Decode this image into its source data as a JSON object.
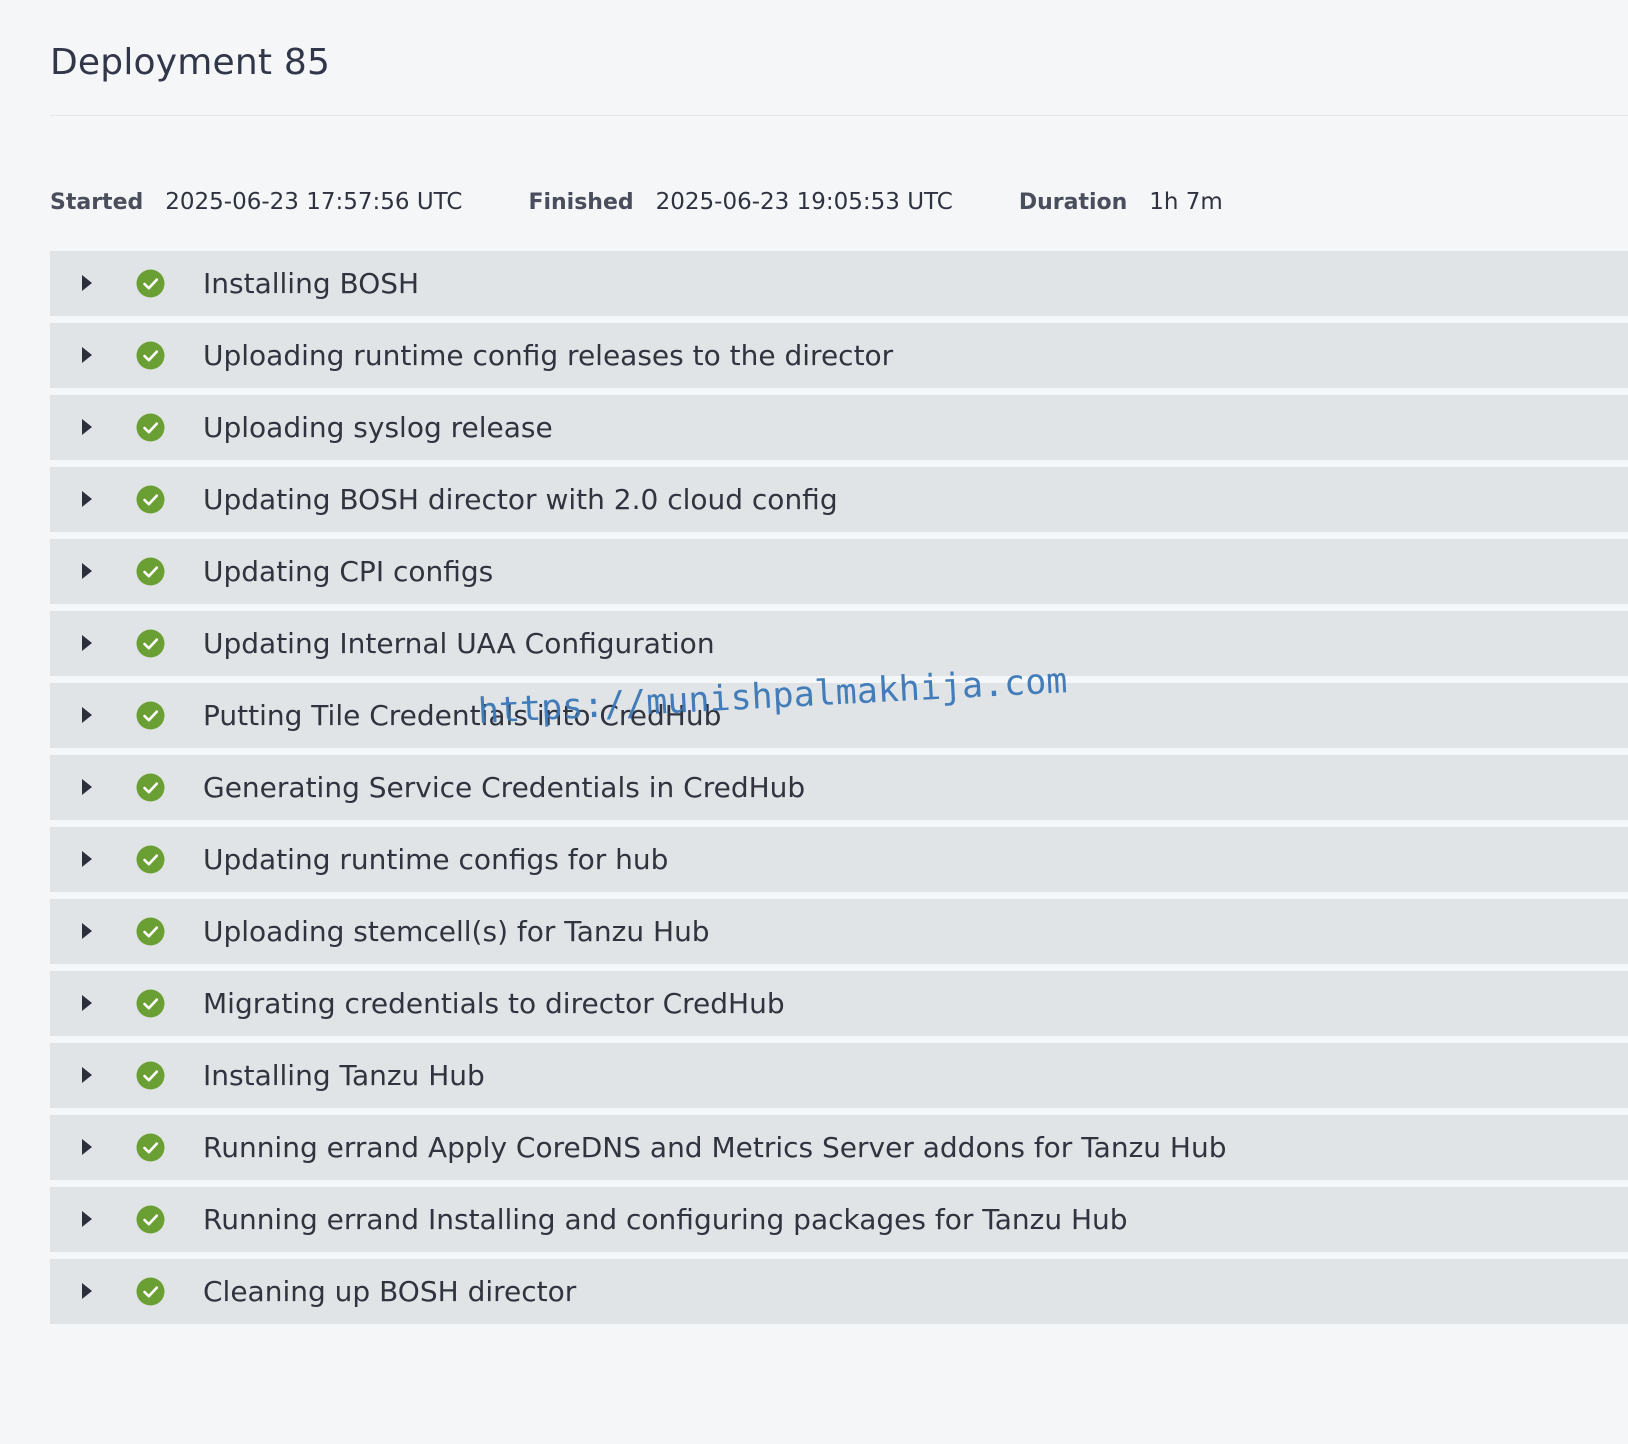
{
  "page": {
    "title": "Deployment 85"
  },
  "meta": {
    "started_label": "Started",
    "started_value": "2025-06-23 17:57:56 UTC",
    "finished_label": "Finished",
    "finished_value": "2025-06-23 19:05:53 UTC",
    "duration_label": "Duration",
    "duration_value": "1h 7m"
  },
  "steps": [
    {
      "label": "Installing BOSH",
      "status": "success"
    },
    {
      "label": "Uploading runtime config releases to the director",
      "status": "success"
    },
    {
      "label": "Uploading syslog release",
      "status": "success"
    },
    {
      "label": "Updating BOSH director with 2.0 cloud config",
      "status": "success"
    },
    {
      "label": "Updating CPI configs",
      "status": "success"
    },
    {
      "label": "Updating Internal UAA Configuration",
      "status": "success"
    },
    {
      "label": "Putting Tile Credentials into CredHub",
      "status": "success"
    },
    {
      "label": "Generating Service Credentials in CredHub",
      "status": "success"
    },
    {
      "label": "Updating runtime configs for hub",
      "status": "success"
    },
    {
      "label": "Uploading stemcell(s) for Tanzu Hub",
      "status": "success"
    },
    {
      "label": "Migrating credentials to director CredHub",
      "status": "success"
    },
    {
      "label": "Installing Tanzu Hub",
      "status": "success"
    },
    {
      "label": "Running errand Apply CoreDNS and Metrics Server addons for Tanzu Hub",
      "status": "success"
    },
    {
      "label": "Running errand Installing and configuring packages for Tanzu Hub",
      "status": "success"
    },
    {
      "label": "Cleaning up BOSH director",
      "status": "success"
    }
  ],
  "watermark": {
    "text": "https://munishpalmakhija.com"
  },
  "icons": {
    "expand": "caret-right-icon",
    "status_success": "check-circle-icon"
  },
  "colors": {
    "background": "#f5f6f8",
    "row_background": "#e1e4e6",
    "success_green": "#6aa033",
    "watermark_blue": "#3a78b8"
  }
}
